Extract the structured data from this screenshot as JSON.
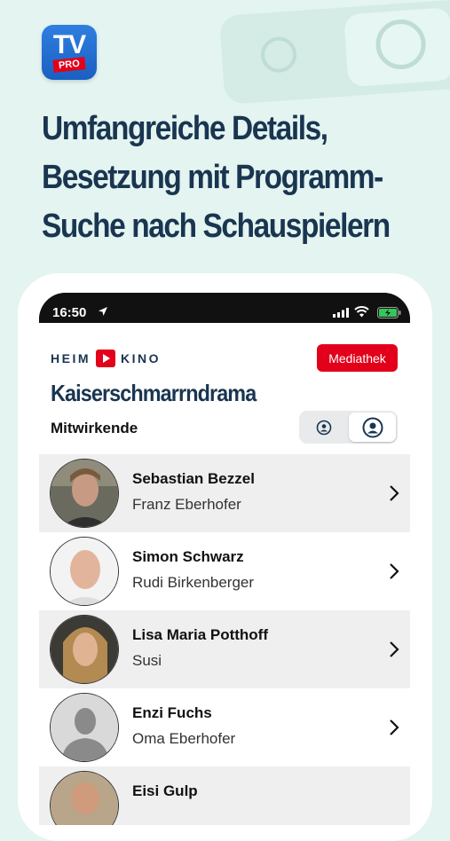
{
  "promo": {
    "logo": {
      "tv": "TV",
      "pro": "PRO"
    },
    "headline": [
      "Umfangreiche Details,",
      "Besetzung mit Programm-",
      "Suche nach Schauspielern"
    ]
  },
  "status_bar": {
    "time": "16:50"
  },
  "header": {
    "brand_left": "HEIM",
    "brand_right": "KINO",
    "mediathek_label": "Mediathek"
  },
  "page": {
    "title": "Kaiserschmarrndrama",
    "section": "Mitwirkende"
  },
  "view_toggle": {
    "options": [
      "person-small-icon",
      "person-large-icon"
    ],
    "selected": 1
  },
  "cast": [
    {
      "name": "Sebastian Bezzel",
      "role": "Franz Eberhofer",
      "avatar": "photo"
    },
    {
      "name": "Simon Schwarz",
      "role": "Rudi Birkenberger",
      "avatar": "photo"
    },
    {
      "name": "Lisa Maria Potthoff",
      "role": "Susi",
      "avatar": "photo"
    },
    {
      "name": "Enzi Fuchs",
      "role": "Oma Eberhofer",
      "avatar": "placeholder"
    },
    {
      "name": "Eisi Gulp",
      "role": "",
      "avatar": "photo"
    }
  ],
  "colors": {
    "background": "#e3f4f1",
    "navy": "#1a3550",
    "red": "#e2001a",
    "row_alt": "#efefef"
  }
}
